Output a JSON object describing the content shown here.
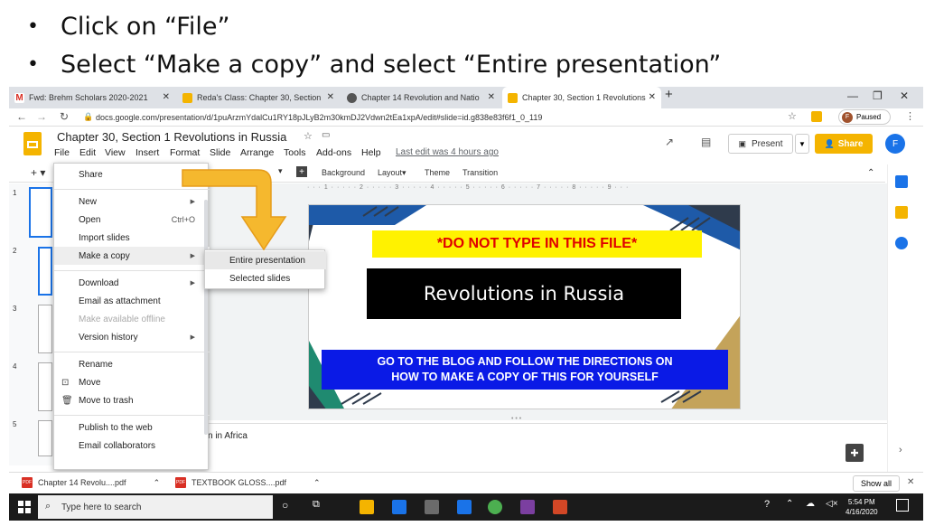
{
  "bullets": [
    "Click on “File”",
    "Select “Make a copy” and select “Entire presentation”"
  ],
  "tabs": [
    {
      "label": "Fwd: Brehm Scholars 2020-2021",
      "favicon": "gmail-icon"
    },
    {
      "label": "Reda's Class: Chapter 30, Section",
      "favicon": "classroom-icon"
    },
    {
      "label": "Chapter 14 Revolution and Natio",
      "favicon": "globe-icon"
    },
    {
      "label": "Chapter 30, Section 1 Revolutions",
      "favicon": "slides-icon"
    }
  ],
  "new_tab_label": "+",
  "address": {
    "url": "docs.google.com/presentation/d/1puArzmYdalCu1RY18pJLyB2m30kmDJ2Vdwn2tEa1xpA/edit#slide=id.g838e83f6f1_0_119",
    "paused_label": "Paused",
    "paused_avatar": "F"
  },
  "docs": {
    "title": "Chapter 30, Section 1 Revolutions in Russia",
    "menu": [
      "File",
      "Edit",
      "View",
      "Insert",
      "Format",
      "Slide",
      "Arrange",
      "Tools",
      "Add-ons",
      "Help"
    ],
    "last_edit": "Last edit was 4 hours ago",
    "present_label": "Present",
    "share_label": "Share",
    "avatar": "F"
  },
  "toolbar": {
    "background": "Background",
    "layout": "Layout▾",
    "theme": "Theme",
    "transition": "Transition"
  },
  "ruler": "· · · 1 · · · · · 2 · · · · · 3 · · · · · 4 · · · · · 5 · · · · · 6 · · · · · 7 · · · · · 8 · · · · · 9 · · ·",
  "filmstrip": [
    "1",
    "2",
    "3",
    "4",
    "5"
  ],
  "slide": {
    "warning": "*DO NOT TYPE IN THIS FILE*",
    "title": "Revolutions in Russia",
    "instructions_line1": "GO TO THE BLOG AND FOLLOW THE DIRECTIONS ON",
    "instructions_line2": "HOW TO MAKE A COPY OF THIS FOR YOURSELF"
  },
  "notes_text": "n in Africa",
  "file_menu": {
    "share": "Share",
    "new": "New",
    "open": "Open",
    "open_shortcut": "Ctrl+O",
    "import_slides": "Import slides",
    "make_copy": "Make a copy",
    "download": "Download",
    "email_attachment": "Email as attachment",
    "available_offline": "Make available offline",
    "version_history": "Version history",
    "rename": "Rename",
    "move": "Move",
    "move_to_trash": "Move to trash",
    "publish": "Publish to the web",
    "email_collaborators": "Email collaborators"
  },
  "submenu": {
    "entire": "Entire presentation",
    "selected": "Selected slides"
  },
  "downloads": [
    {
      "name": "Chapter 14 Revolu....pdf",
      "badge": "PDF"
    },
    {
      "name": "TEXTBOOK GLOSS....pdf",
      "badge": "PDF"
    }
  ],
  "show_all": "Show all",
  "taskbar": {
    "search_placeholder": "Type here to search",
    "time": "5:54 PM",
    "date": "4/16/2020"
  },
  "colors": {
    "accent_arrow": "#f5b82e",
    "share": "#f4b400",
    "slide_blue": "#0a1ae6",
    "warn_yellow": "#fff200",
    "warn_red": "#e00000"
  }
}
